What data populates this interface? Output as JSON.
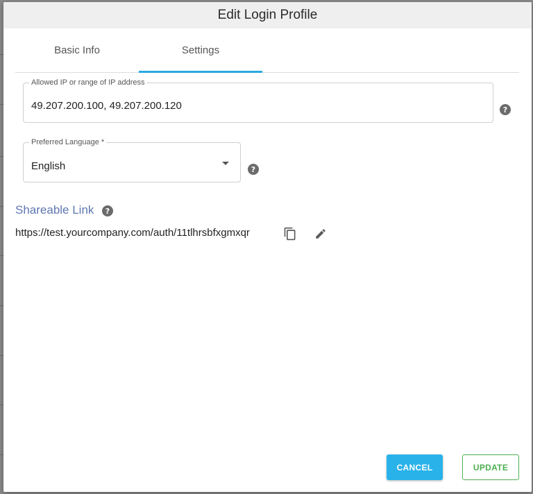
{
  "dialog": {
    "title": "Edit Login Profile"
  },
  "tabs": [
    {
      "label": "Basic Info",
      "active": false
    },
    {
      "label": "Settings",
      "active": true
    }
  ],
  "allowed_ip": {
    "label": "Allowed IP or range of IP address",
    "value": "49.207.200.100, 49.207.200.120"
  },
  "language": {
    "label": "Preferred Language *",
    "value": "English"
  },
  "shareable_link": {
    "title": "Shareable Link",
    "url": "https://test.yourcompany.com/auth/11tlhrsbfxgmxqr"
  },
  "actions": {
    "cancel_label": "CANCEL",
    "update_label": "UPDATE"
  },
  "icons": {
    "help": "help-circle-icon",
    "copy": "copy-icon",
    "edit": "pencil-icon",
    "dropdown": "caret-down-icon"
  },
  "colors": {
    "accent": "#29a9e0",
    "cancel_bg": "#29b2ea",
    "update_border": "#4caf50",
    "link_title": "#5e77b0"
  }
}
